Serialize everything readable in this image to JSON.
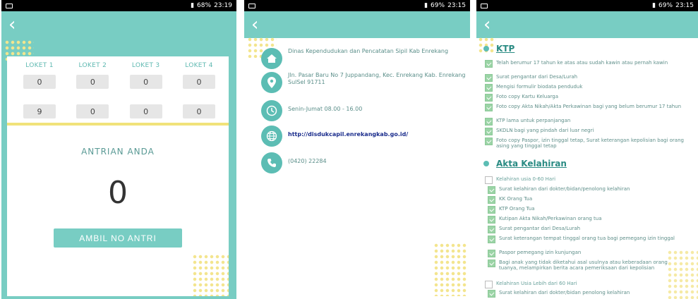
{
  "screens": [
    {
      "status": {
        "percent": "68%",
        "time": "23:19"
      }
    },
    {
      "status": {
        "percent": "69%",
        "time": "23:15"
      }
    },
    {
      "status": {
        "percent": "69%",
        "time": "23:15"
      }
    }
  ],
  "back_icon": "chevron-left-icon",
  "queue": {
    "loket_labels": [
      "LOKET 1",
      "LOKET 2",
      "LOKET 3",
      "LOKET 4"
    ],
    "row1_values": [
      "0",
      "0",
      "0",
      "0"
    ],
    "row2_values": [
      "9",
      "0",
      "0",
      "0"
    ],
    "antrian_title": "ANTRIAN ANDA",
    "antrian_number": "0",
    "button_label": "AMBIL NO ANTRI"
  },
  "contact": {
    "office": "Dinas Kependudukan dan Pencatatan Sipil Kab Enrekang",
    "address": "Jln. Pasar Baru No 7 Juppandang, Kec. Enrekang Kab. Enrekang SulSel 91711",
    "hours": "Senin-Jumat 08.00 - 16.00",
    "website": "http://disdukcapil.enrekangkab.go.id/",
    "phone": "(0420) 22284",
    "icons": [
      "home-icon",
      "location-pin-icon",
      "clock-icon",
      "globe-icon",
      "phone-icon"
    ]
  },
  "requirements": {
    "ktp_title": "KTP",
    "ktp_items": [
      "Telah berumur 17 tahun ke atas atau sudah kawin atau pernah kawin",
      "Surat pengantar dari Desa/Lurah",
      "Mengisi formulir biodata penduduk",
      "Foto copy Kartu Keluarga",
      "Foto copy Akta Nikah/Akta Perkawinan bagi yang belum berumur 17 tahun",
      "KTP lama untuk perpanjangan",
      "SKDLN bagi yang pindah dari luar negri",
      "Foto copy Paspor, izin tinggal tetap, Surat keterangan kepolisian bagi orang asing yang tinggal tetap"
    ],
    "akta_title": "Akta Kelahiran",
    "akta_items": [
      "Kelahiran usia 0-60 Hari",
      "Surat kelahiran dari dokter/bidan/penolong kelahiran",
      "KK Orang Tua",
      "KTP Orang Tua",
      "Kutipan Akta Nikah/Perkawinan orang tua",
      "Surat pengantar dari Desa/Lurah",
      "Surat keterangan tempat tinggal orang tua bagi pemegang izin tinggal",
      "Paspor pemegang izin kunjungan",
      "Bagi anak yang tidak diketahui asal usulnya atau keberadaan orang tuanya, melampirkan berita acara pemeriksaan dari kepolisian",
      "Kelahiran Usia Lebih dari 60 Hari",
      "Surat kelahiran dari dokter/bidan penolong kelahiran"
    ]
  }
}
